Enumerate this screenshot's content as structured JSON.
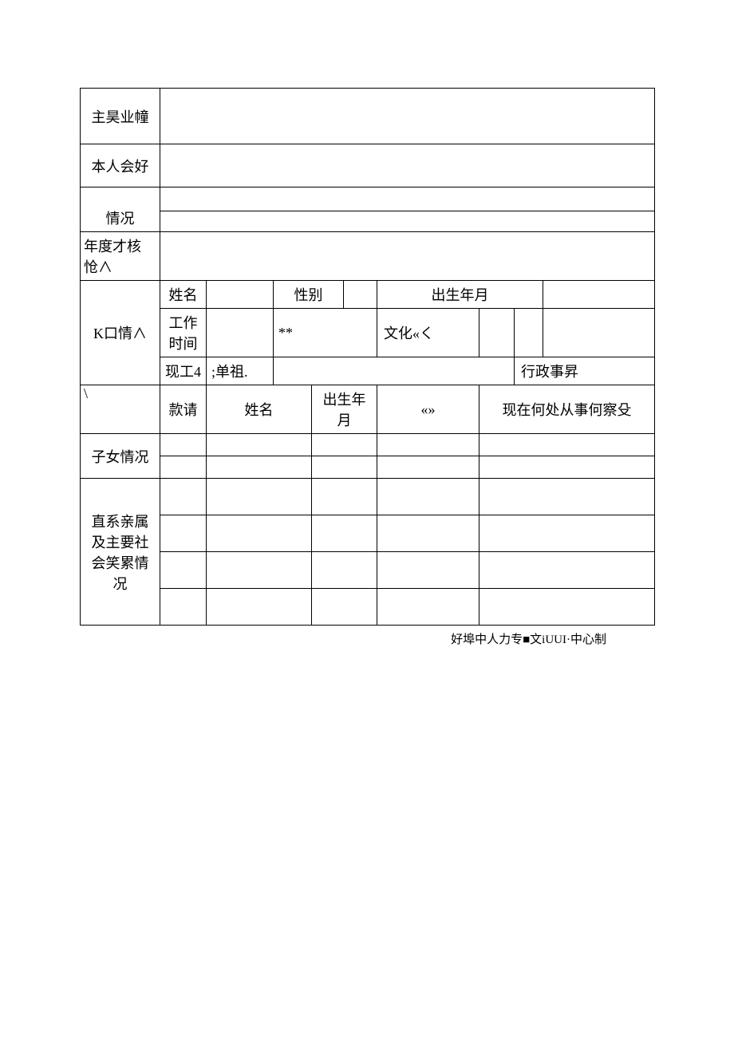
{
  "rows": {
    "r1_label": "主昊业幢",
    "r2_label": "本人会好",
    "r3_label": "情况",
    "r4_label": "年度才核怆∧"
  },
  "spouse": {
    "section_label": "K口情∧",
    "name_label": "姓名",
    "sex_label": "性别",
    "dob_label": "出生年月",
    "worktime_label": "工作时间",
    "stars": "**",
    "culture_label": "文化«く",
    "unit_label": "现工4",
    "unit_val_hint": ";单祖.",
    "admin_label": "行政事昇"
  },
  "family": {
    "corner": "\\",
    "rel_label": "款请",
    "name_label": "姓名",
    "dob_label": "出生年月",
    "mid_label": "«»",
    "work_label": "现在何处从事何察殳",
    "children_label": "子女情况",
    "relatives_label": "直系亲属及主要社会笑累情况"
  },
  "footer": "好埠中人力专■文iUUI·中心制"
}
